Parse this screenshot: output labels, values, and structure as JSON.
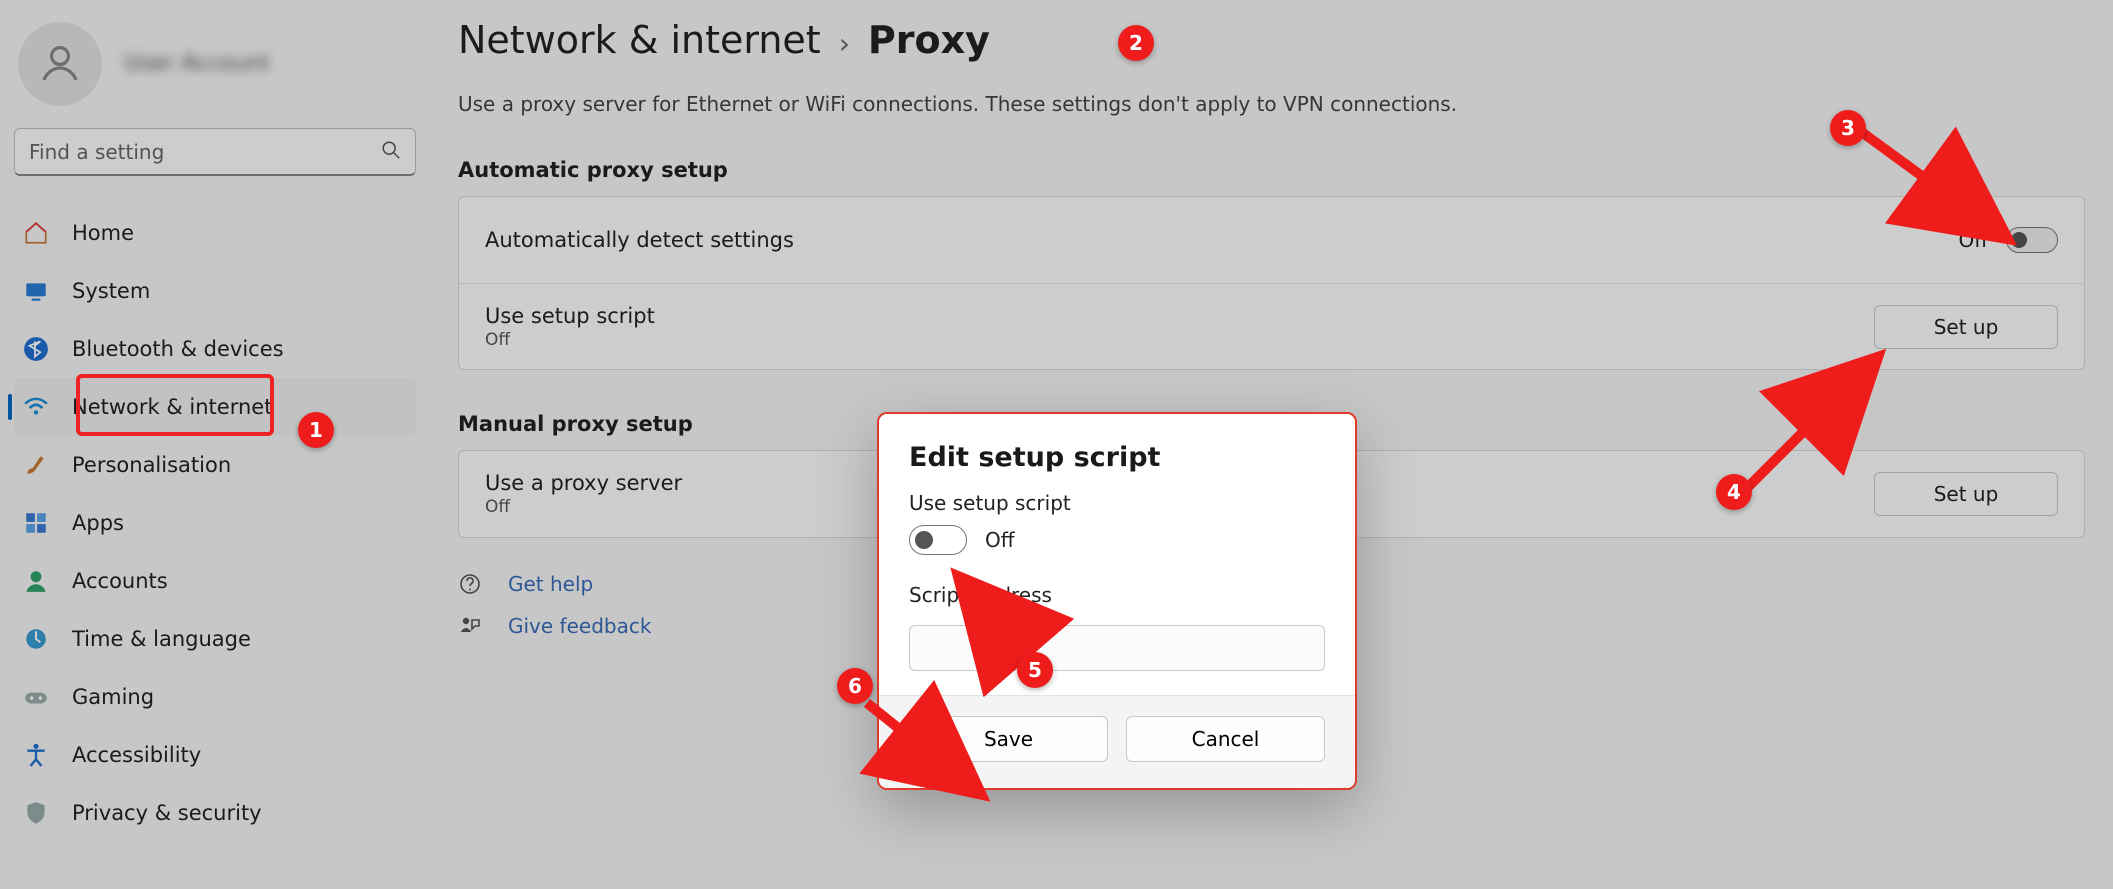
{
  "profile": {
    "name": "User Account"
  },
  "search": {
    "placeholder": "Find a setting"
  },
  "sidebar": {
    "items": [
      {
        "label": "Home"
      },
      {
        "label": "System"
      },
      {
        "label": "Bluetooth & devices"
      },
      {
        "label": "Network & internet"
      },
      {
        "label": "Personalisation"
      },
      {
        "label": "Apps"
      },
      {
        "label": "Accounts"
      },
      {
        "label": "Time & language"
      },
      {
        "label": "Gaming"
      },
      {
        "label": "Accessibility"
      },
      {
        "label": "Privacy & security"
      }
    ]
  },
  "breadcrumb": {
    "parent": "Network & internet",
    "sep": "›",
    "current": "Proxy"
  },
  "subtitle": "Use a proxy server for Ethernet or WiFi connections. These settings don't apply to VPN connections.",
  "sections": {
    "auto": {
      "title": "Automatic proxy setup",
      "detect": {
        "label": "Automatically detect settings",
        "state": "Off"
      },
      "script": {
        "label": "Use setup script",
        "state": "Off",
        "button": "Set up"
      }
    },
    "manual": {
      "title": "Manual proxy setup",
      "proxy": {
        "label": "Use a proxy server",
        "state": "Off",
        "button": "Set up"
      }
    }
  },
  "links": {
    "help": "Get help",
    "feedback": "Give feedback"
  },
  "dialog": {
    "title": "Edit setup script",
    "use_label": "Use setup script",
    "state": "Off",
    "addr_label": "Script address",
    "addr_value": "",
    "save": "Save",
    "cancel": "Cancel"
  },
  "annotations": {
    "b1": "1",
    "b2": "2",
    "b3": "3",
    "b4": "4",
    "b5": "5",
    "b6": "6"
  }
}
